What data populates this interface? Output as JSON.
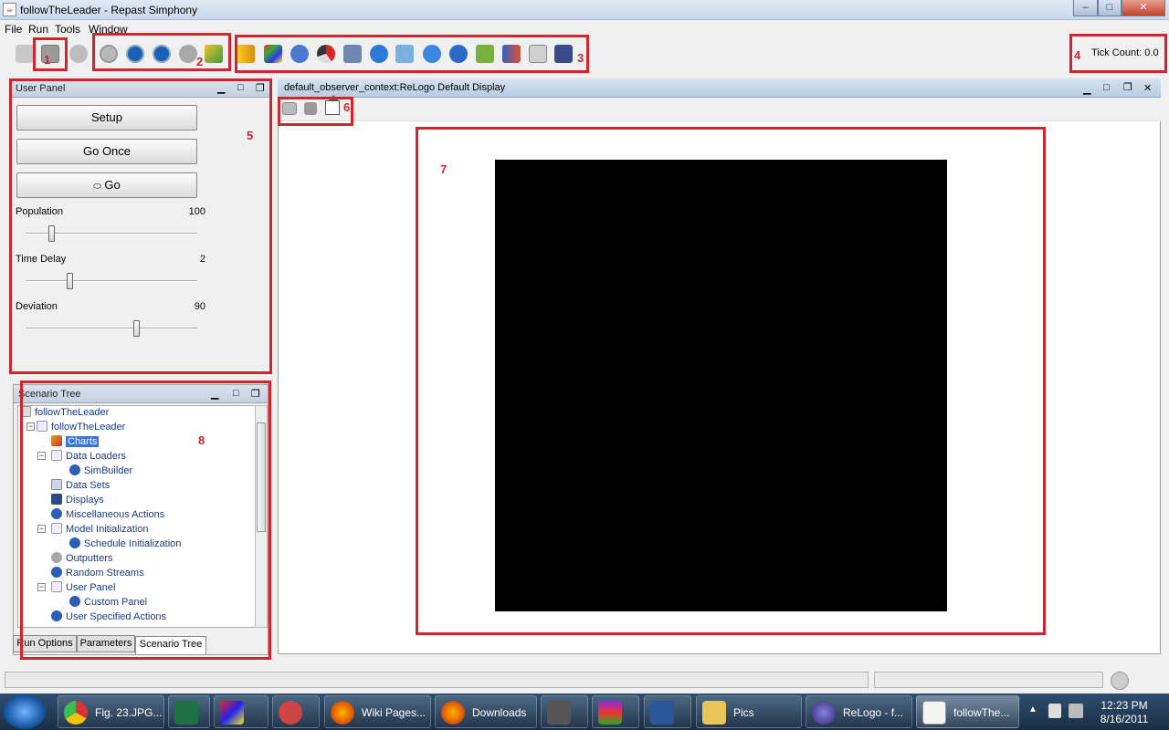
{
  "window": {
    "title": "followTheLeader - Repast Simphony",
    "min": "–",
    "max": "□",
    "close": "✕"
  },
  "menu": [
    "File",
    "Run",
    "Tools",
    "Window"
  ],
  "tick_count": "Tick Count: 0.0",
  "annotations": [
    "1",
    "2",
    "3",
    "4",
    "5",
    "6",
    "7",
    "8"
  ],
  "user_panel": {
    "title": "User Panel",
    "buttons": {
      "setup": "Setup",
      "go_once": "Go Once",
      "go": "Go",
      "go_glyph": "⬭"
    },
    "sliders": [
      {
        "label": "Population",
        "value": "100",
        "level": 0.14
      },
      {
        "label": "Time Delay",
        "value": "2",
        "level": 0.25
      },
      {
        "label": "Deviation",
        "value": "90",
        "level": 0.65
      }
    ]
  },
  "scenario_tree": {
    "title": "Scenario Tree",
    "items": [
      "followTheLeader",
      "followTheLeader",
      "Charts",
      "Data Loaders",
      "SimBuilder",
      "Data Sets",
      "Displays",
      "Miscellaneous Actions",
      "Model Initialization",
      "Schedule Initialization",
      "Outputters",
      "Random Streams",
      "User Panel",
      "Custom Panel",
      "User Specified Actions"
    ],
    "tabs": [
      "Run Options",
      "Parameters",
      "Scenario Tree"
    ]
  },
  "display": {
    "title": "default_observer_context:ReLogo Default Display"
  },
  "taskbar": {
    "items": [
      {
        "label": "Fig. 23.JPG..."
      },
      {
        "label": "Wiki Pages..."
      },
      {
        "label": "Downloads"
      },
      {
        "label": "Pics"
      },
      {
        "label": "ReLogo - f..."
      },
      {
        "label": "followThe..."
      }
    ],
    "time": "12:23 PM",
    "date": "8/16/2011"
  },
  "colors": {
    "annotation": "#d0252d",
    "selection": "#3875d7",
    "canvas": "#000000"
  }
}
